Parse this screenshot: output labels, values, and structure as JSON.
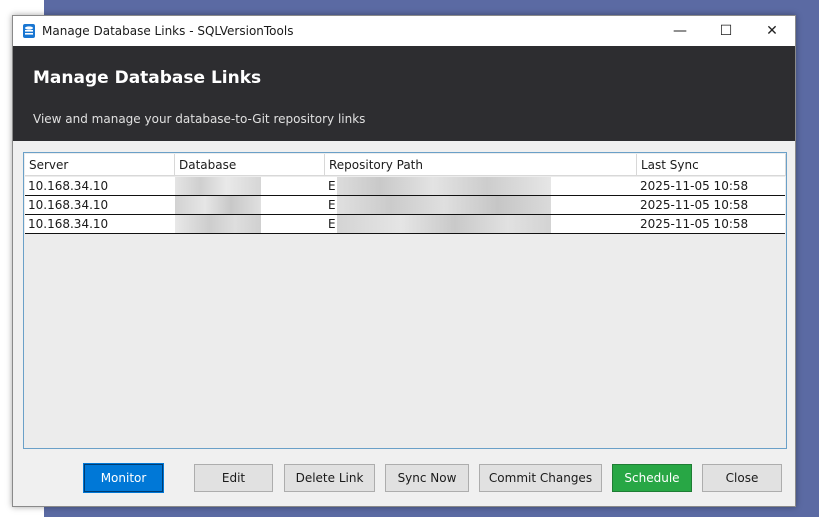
{
  "window": {
    "title": "Manage Database Links - SQLVersionTools",
    "controls": {
      "minimize": "—",
      "maximize": "☐",
      "close": "✕"
    }
  },
  "header": {
    "title": "Manage Database Links",
    "subtitle": "View and manage your database-to-Git repository links"
  },
  "grid": {
    "columns": [
      "Server",
      "Database",
      "Repository Path",
      "Last Sync"
    ],
    "rows": [
      {
        "server": "10.168.34.10",
        "database": "",
        "repository_path": "E:",
        "last_sync": "2025-11-05 10:58"
      },
      {
        "server": "10.168.34.10",
        "database": "",
        "repository_path": "E:",
        "last_sync": "2025-11-05 10:58"
      },
      {
        "server": "10.168.34.10",
        "database": "",
        "repository_path": "E:",
        "last_sync": "2025-11-05 10:58"
      }
    ]
  },
  "buttons": {
    "monitor": "Monitor",
    "edit": "Edit",
    "delete_link": "Delete Link",
    "sync_now": "Sync Now",
    "commit_changes": "Commit Changes",
    "schedule": "Schedule",
    "close": "Close"
  },
  "colors": {
    "header_bg": "#2d2d30",
    "primary_button": "#0078d7",
    "schedule_button": "#28a745",
    "desktop_bg": "#5b6aa3"
  }
}
